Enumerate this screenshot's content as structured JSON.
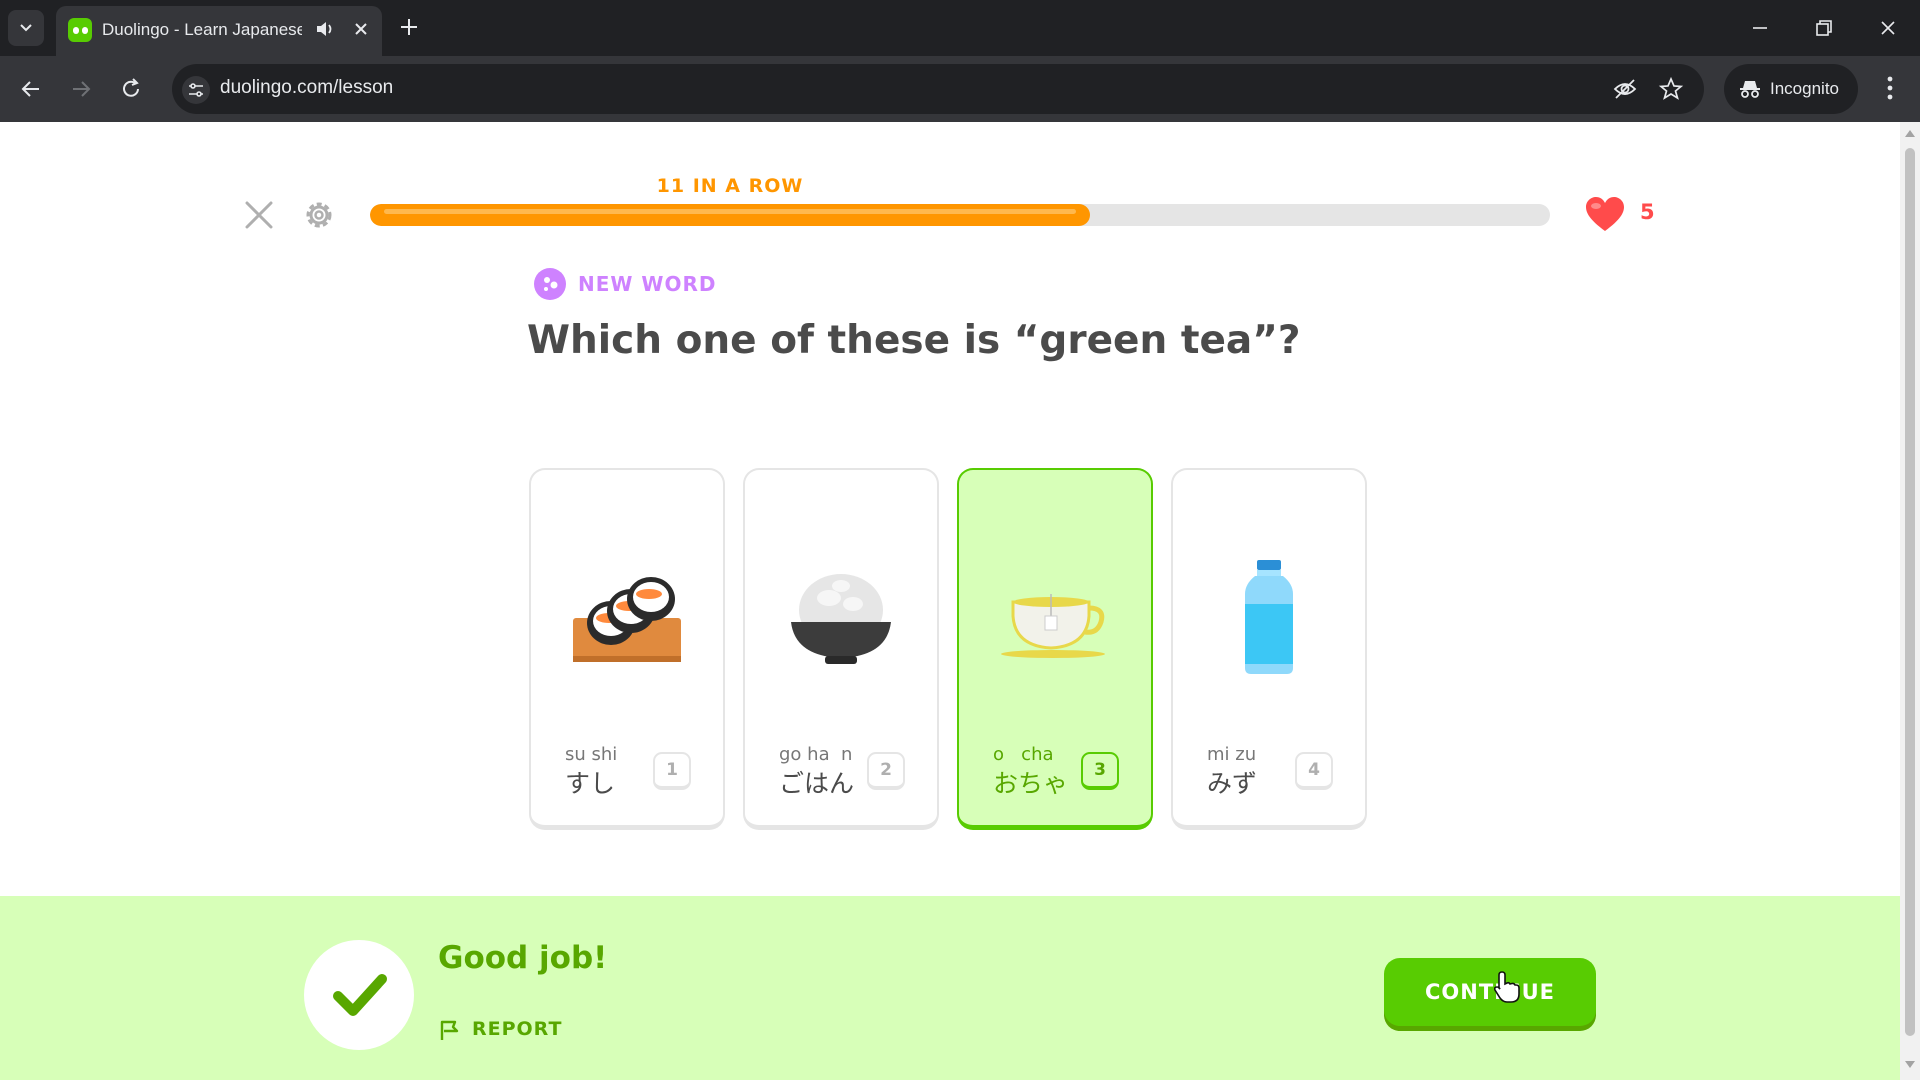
{
  "browser": {
    "tab_title": "Duolingo - Learn Japanese",
    "url": "duolingo.com/lesson",
    "incognito_label": "Incognito"
  },
  "lesson": {
    "streak_label": "11 IN A ROW",
    "progress": 0.61,
    "hearts": "5",
    "challenge_type": "NEW WORD",
    "question": "Which one of these is “green tea”?",
    "choices": [
      {
        "romaji": "su shi",
        "kana": "すし",
        "key": "1",
        "icon": "sushi-icon"
      },
      {
        "romaji": "go ha  n",
        "kana": "ごはん",
        "key": "2",
        "icon": "rice-bowl-icon"
      },
      {
        "romaji": "o   cha",
        "kana": "おちゃ",
        "key": "3",
        "icon": "tea-cup-icon",
        "selected": true
      },
      {
        "romaji": "mi zu",
        "kana": "みず",
        "key": "4",
        "icon": "water-bottle-icon"
      }
    ]
  },
  "feedback": {
    "message": "Good job!",
    "report_label": "REPORT",
    "continue_label": "CONTINUE"
  },
  "colors": {
    "accent_green": "#58cc02",
    "correct_bg": "#d7ffb8",
    "streak_orange": "#ff9600",
    "heart_red": "#ff4b4b",
    "new_word_purple": "#ce82ff"
  }
}
